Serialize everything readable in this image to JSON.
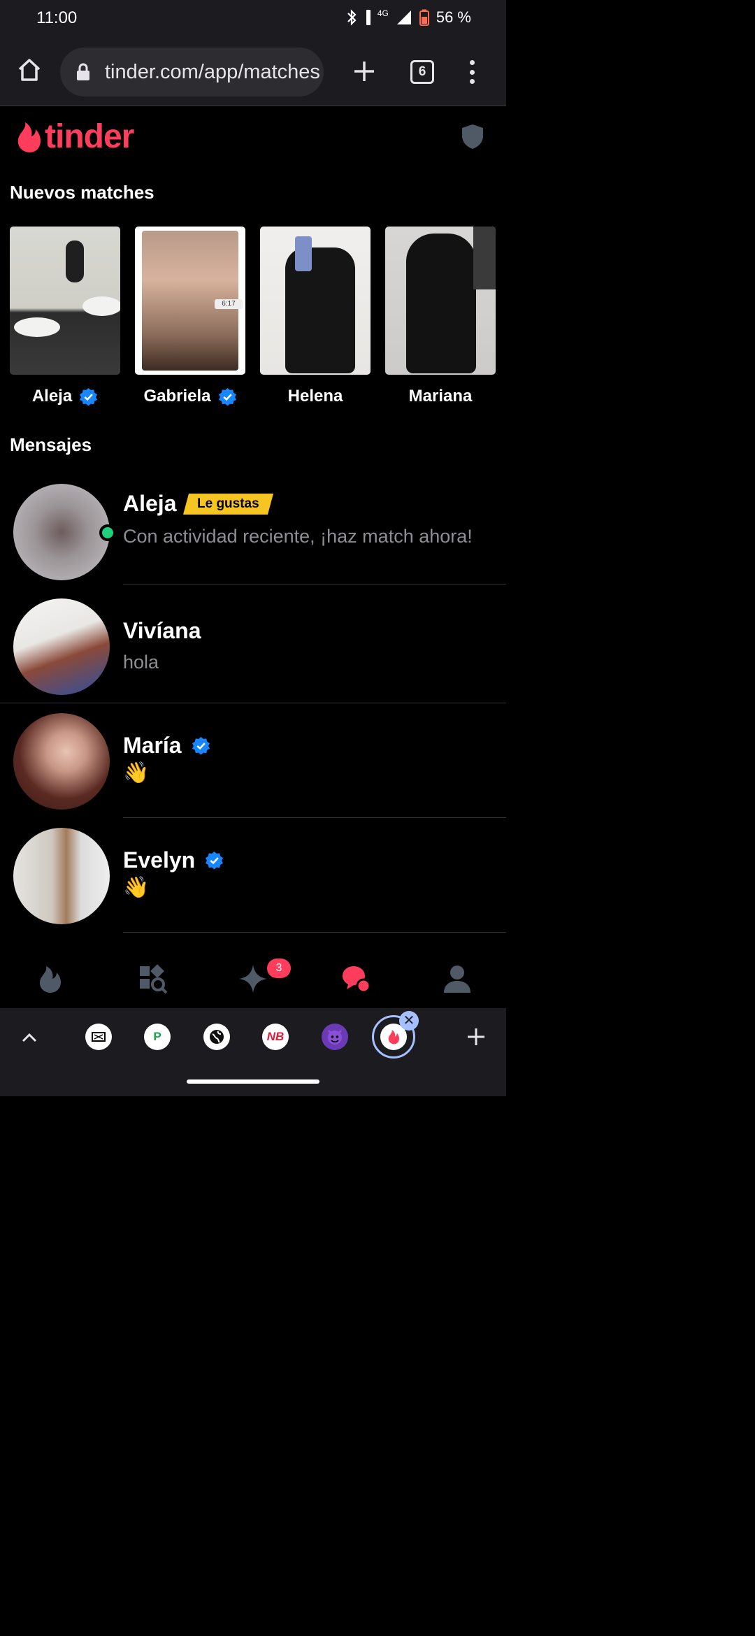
{
  "status_bar": {
    "time": "11:00",
    "network": "4G",
    "battery": "56 %"
  },
  "browser": {
    "url": "tinder.com/app/matches",
    "tab_count": "6"
  },
  "app": {
    "logo_text": "tinder",
    "brand_color": "#fe3c5b"
  },
  "new_matches": {
    "title": "Nuevos matches",
    "items": [
      {
        "name": "Aleja",
        "verified": true
      },
      {
        "name": "Gabriela",
        "verified": true,
        "video_time": "6:17"
      },
      {
        "name": "Helena",
        "verified": false
      },
      {
        "name": "Mariana",
        "verified": false
      }
    ]
  },
  "messages": {
    "title": "Mensajes",
    "items": [
      {
        "name": "Aleja",
        "badge": "Le gustas",
        "preview": "Con actividad reciente, ¡haz match ahora!",
        "online": true
      },
      {
        "name": "Vivíana",
        "preview": "hola"
      },
      {
        "name": "María",
        "preview": "👋",
        "verified": true
      },
      {
        "name": "Evelyn",
        "preview": "👋",
        "verified": true
      }
    ]
  },
  "bottom_nav": {
    "items": [
      "flame-icon",
      "explore-icon",
      "sparkle-icon",
      "messages-icon",
      "profile-icon"
    ],
    "sparkle_badge": "3"
  },
  "tab_strip": {
    "icons": [
      "nba-icon",
      "p-icon",
      "globe-icon",
      "newbalance-icon",
      "devil-icon",
      "tinder-icon"
    ]
  }
}
